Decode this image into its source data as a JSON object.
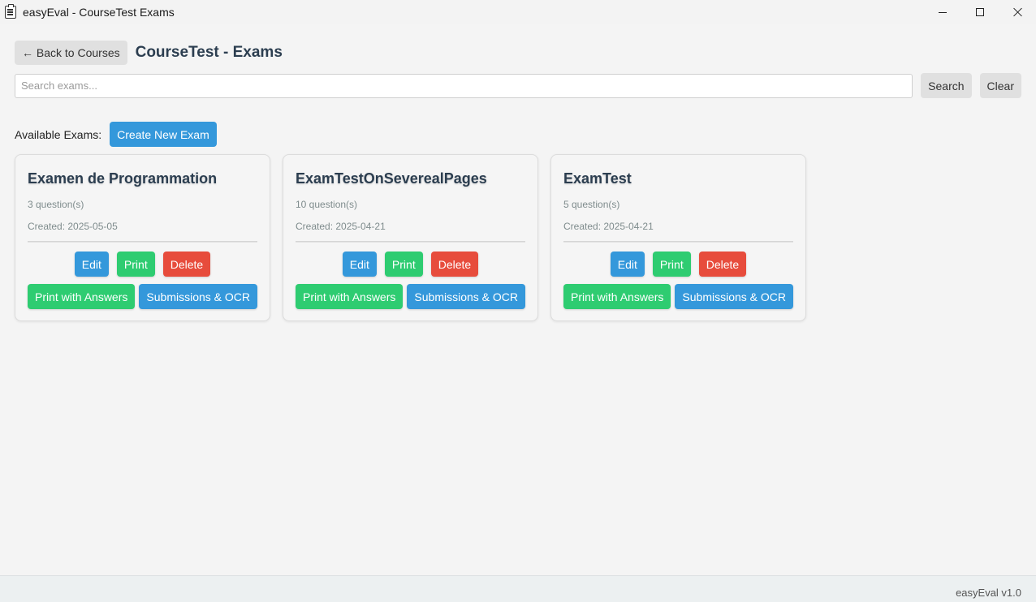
{
  "window": {
    "title": "easyEval - CourseTest Exams"
  },
  "header": {
    "back_label": "← Back to Courses",
    "page_title": "CourseTest - Exams"
  },
  "search": {
    "placeholder": "Search exams...",
    "value": "",
    "search_label": "Search",
    "clear_label": "Clear"
  },
  "exams_section": {
    "label": "Available Exams:",
    "create_label": "Create New Exam"
  },
  "cards": [
    {
      "title": "Examen de Programmation",
      "questions": "3 question(s)",
      "created": "Created: 2025-05-05",
      "edit_label": "Edit",
      "print_label": "Print",
      "delete_label": "Delete",
      "print_answers_label": "Print with Answers",
      "submissions_label": "Submissions & OCR"
    },
    {
      "title": "ExamTestOnSeverealPages",
      "questions": "10 question(s)",
      "created": "Created: 2025-04-21",
      "edit_label": "Edit",
      "print_label": "Print",
      "delete_label": "Delete",
      "print_answers_label": "Print with Answers",
      "submissions_label": "Submissions & OCR"
    },
    {
      "title": "ExamTest",
      "questions": "5 question(s)",
      "created": "Created: 2025-04-21",
      "edit_label": "Edit",
      "print_label": "Print",
      "delete_label": "Delete",
      "print_answers_label": "Print with Answers",
      "submissions_label": "Submissions & OCR"
    }
  ],
  "status": {
    "version": "easyEval v1.0"
  },
  "colors": {
    "blue": "#3498db",
    "green": "#2ecc71",
    "red": "#e74c3c",
    "title": "#2c3e50"
  }
}
